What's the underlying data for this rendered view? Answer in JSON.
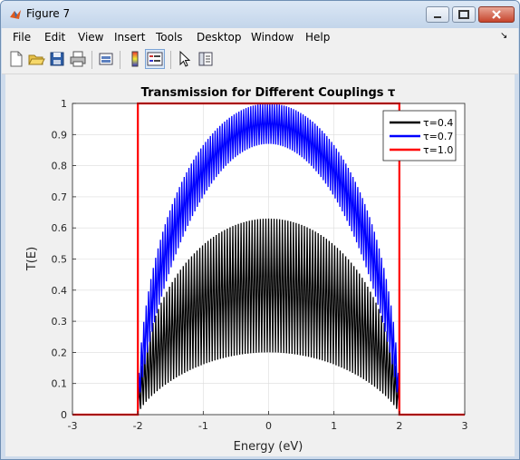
{
  "window": {
    "title": "Figure 7"
  },
  "menu": [
    {
      "label": "File"
    },
    {
      "label": "Edit"
    },
    {
      "label": "View"
    },
    {
      "label": "Insert"
    },
    {
      "label": "Tools"
    },
    {
      "label": "Desktop"
    },
    {
      "label": "Window"
    },
    {
      "label": "Help"
    }
  ],
  "menu_arrow": "↘",
  "toolbar": [
    "new-figure-icon",
    "open-file-icon",
    "save-icon",
    "print-icon",
    "link-plot-icon",
    "insert-colorbar-icon",
    "insert-legend-icon",
    "pointer-icon",
    "property-editor-icon"
  ],
  "colors": {
    "tau_04": "#000000",
    "tau_07": "#0000ff",
    "tau_10": "#ff0000"
  },
  "chart_data": {
    "type": "line",
    "title": "Transmission for Different Couplings τ",
    "xlabel": "Energy (eV)",
    "ylabel": "T(E)",
    "xlim": [
      -3,
      3
    ],
    "ylim": [
      0,
      1
    ],
    "xticks": [
      "-3",
      "-2",
      "-1",
      "0",
      "1",
      "2",
      "3"
    ],
    "yticks": [
      "0",
      "0.1",
      "0.2",
      "0.3",
      "0.4",
      "0.5",
      "0.6",
      "0.7",
      "0.8",
      "0.9",
      "1"
    ],
    "grid": true,
    "legend_position": "top-right",
    "series": [
      {
        "name": "τ=0.4",
        "color": "#000000",
        "band": [
          -2,
          2
        ],
        "peak_max": 0.63,
        "trough_max": 0.2
      },
      {
        "name": "τ=0.7",
        "color": "#0000ff",
        "band": [
          -2,
          2
        ],
        "peak_max": 1.0,
        "trough_max": 0.87
      },
      {
        "name": "τ=1.0",
        "color": "#ff0000",
        "band": [
          -2,
          2
        ],
        "value_in_band": 1.0,
        "value_outside": 0
      }
    ]
  }
}
